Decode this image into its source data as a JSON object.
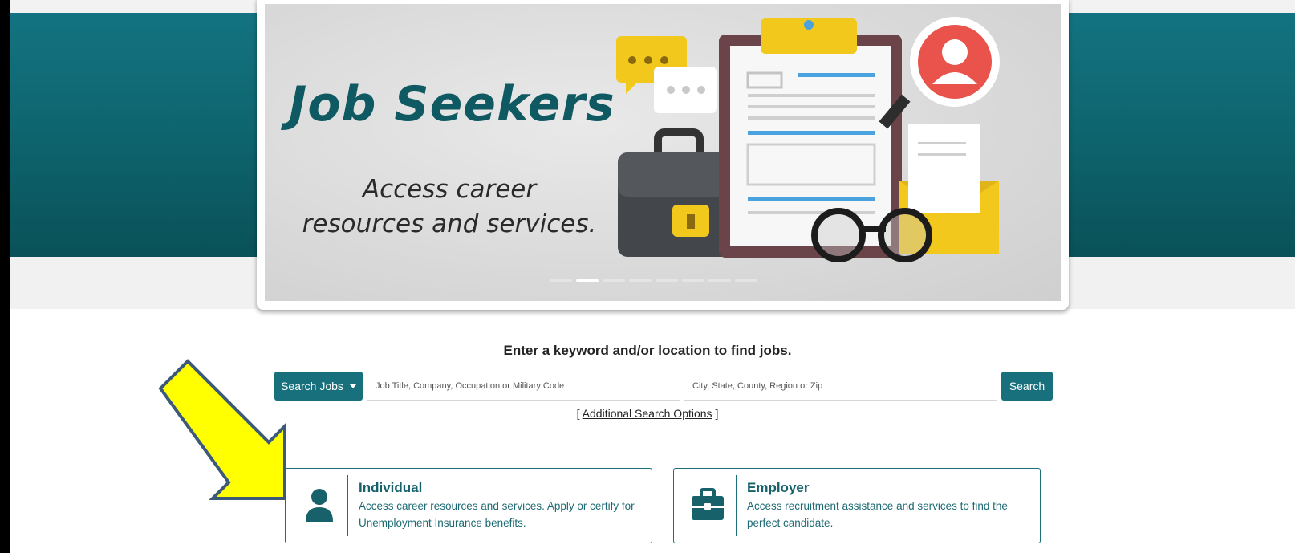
{
  "hero": {
    "title": "Job Seekers",
    "subtitle_line1": "Access career",
    "subtitle_line2": "resources and services."
  },
  "search": {
    "prompt": "Enter a keyword and/or location to find jobs.",
    "mode_label": "Search Jobs",
    "keyword_placeholder": "Job Title, Company, Occupation or Military Code",
    "keyword_value": "",
    "location_placeholder": "City, State, County, Region or Zip",
    "location_value": "",
    "submit_label": "Search",
    "bracket_open": "[",
    "additional_options_label": "Additional Search Options",
    "bracket_close": "]"
  },
  "cards": [
    {
      "title": "Individual",
      "description": "Access career resources and services. Apply or certify for Unemployment Insurance benefits.",
      "icon": "person-icon"
    },
    {
      "title": "Employer",
      "description": "Access recruitment assistance and services to find the perfect candidate.",
      "icon": "briefcase-icon"
    }
  ],
  "colors": {
    "brand_teal": "#17707b",
    "annotation_arrow": "#ffff00"
  }
}
